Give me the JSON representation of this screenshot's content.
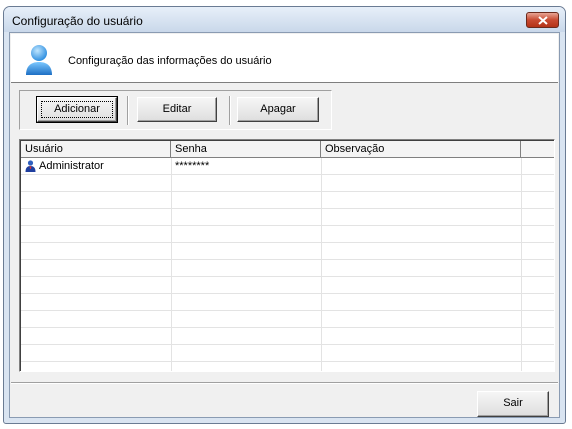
{
  "window": {
    "title": "Configuração do usuário",
    "close_label": "Fechar"
  },
  "header": {
    "text": "Configuração das informações do usuário"
  },
  "toolbar": {
    "add_label": "Adicionar",
    "edit_label": "Editar",
    "delete_label": "Apagar"
  },
  "table": {
    "columns": [
      "Usuário",
      "Senha",
      "Observação"
    ],
    "rows": [
      {
        "user": "Administrator",
        "password": "********",
        "note": ""
      }
    ]
  },
  "footer": {
    "exit_label": "Sair"
  }
}
